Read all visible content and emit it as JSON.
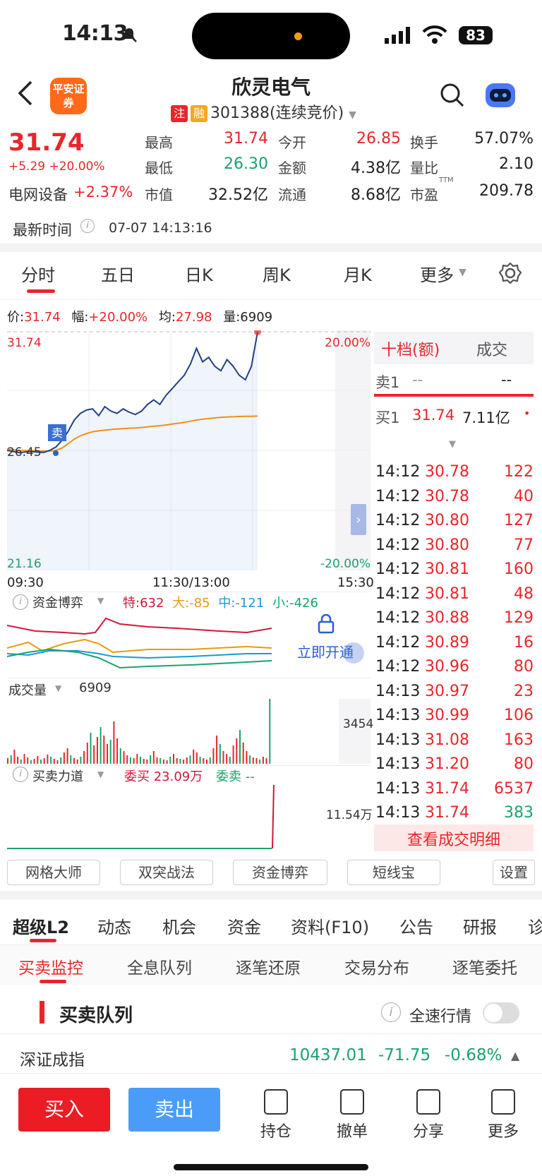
{
  "status": {
    "time": "14:13",
    "battery": "83"
  },
  "header": {
    "logo": "平安证券",
    "name": "欣灵电气",
    "badge_zhu": "注",
    "badge_rong": "融",
    "code": "301388(连续竞价)"
  },
  "quote": {
    "price": "31.74",
    "change": "+5.29 +20.00%",
    "sector": "电网设备",
    "sector_change": "+2.37%",
    "high_label": "最高",
    "high": "31.74",
    "open_label": "今开",
    "open": "26.85",
    "turnover_label": "换手",
    "turnover": "57.07%",
    "low_label": "最低",
    "low": "26.30",
    "amount_label": "金额",
    "amount": "4.38亿",
    "vol_ratio_label": "量比",
    "vol_ratio": "2.10",
    "mcap_label": "市值",
    "mcap": "32.52亿",
    "float_label": "流通",
    "float": "8.68亿",
    "pe_label": "市盈",
    "pe_sup": "TTM",
    "pe": "209.78",
    "time_label": "最新时间",
    "time_value": "07-07 14:13:16"
  },
  "chart_tabs": [
    "分时",
    "五日",
    "日K",
    "周K",
    "月K",
    "更多"
  ],
  "chart_info": {
    "price_label": "价:",
    "price": "31.74",
    "range_label": "幅:",
    "range": "+20.00%",
    "avg_label": "均:",
    "avg": "27.98",
    "vol_label": "量:",
    "vol": "6909"
  },
  "chart_data": {
    "type": "line",
    "x_labels": [
      "09:30",
      "11:30/13:00",
      "15:30"
    ],
    "y_left": [
      "31.74",
      "26.45",
      "21.16"
    ],
    "y_right": [
      "20.00%",
      "-20.00%"
    ],
    "series": [
      {
        "name": "价",
        "values": [
          26.45,
          26.4,
          26.35,
          26.38,
          26.4,
          26.37,
          26.36,
          26.45,
          26.6,
          26.9,
          27.3,
          27.8,
          28.1,
          28.25,
          28.3,
          28.0,
          28.4,
          28.2,
          28.1,
          28.3,
          28.15,
          28.05,
          28.2,
          28.5,
          28.7,
          28.5,
          28.9,
          29.2,
          29.5,
          29.8,
          30.3,
          31.0,
          30.4,
          30.6,
          30.2,
          30.0,
          30.5,
          30.2,
          29.8,
          29.6,
          30.2,
          31.74
        ]
      },
      {
        "name": "均",
        "values": [
          26.5,
          26.48,
          26.45,
          26.44,
          26.44,
          26.43,
          26.42,
          26.42,
          26.45,
          26.55,
          26.75,
          26.95,
          27.1,
          27.2,
          27.28,
          27.32,
          27.35,
          27.38,
          27.4,
          27.42,
          27.44,
          27.45,
          27.47,
          27.5,
          27.53,
          27.55,
          27.58,
          27.62,
          27.66,
          27.7,
          27.75,
          27.8,
          27.84,
          27.87,
          27.9,
          27.92,
          27.94,
          27.95,
          27.96,
          27.97,
          27.97,
          27.98
        ]
      }
    ],
    "ylim": [
      21.16,
      31.74
    ]
  },
  "order_book": {
    "tab1": "十档(额)",
    "tab2": "成交",
    "sell1_label": "卖1",
    "sell1_price": "--",
    "sell1_amt": "--",
    "buy1_label": "买1",
    "buy1_price": "31.74",
    "buy1_amt": "7.11亿"
  },
  "trades": [
    {
      "t": "14:12",
      "p": "30.78",
      "v": "122"
    },
    {
      "t": "14:12",
      "p": "30.78",
      "v": "40"
    },
    {
      "t": "14:12",
      "p": "30.80",
      "v": "127"
    },
    {
      "t": "14:12",
      "p": "30.80",
      "v": "77"
    },
    {
      "t": "14:12",
      "p": "30.81",
      "v": "160"
    },
    {
      "t": "14:12",
      "p": "30.81",
      "v": "48"
    },
    {
      "t": "14:12",
      "p": "30.88",
      "v": "129"
    },
    {
      "t": "14:12",
      "p": "30.89",
      "v": "16"
    },
    {
      "t": "14:12",
      "p": "30.96",
      "v": "80"
    },
    {
      "t": "14:13",
      "p": "30.97",
      "v": "23"
    },
    {
      "t": "14:13",
      "p": "30.99",
      "v": "106"
    },
    {
      "t": "14:13",
      "p": "31.08",
      "v": "163"
    },
    {
      "t": "14:13",
      "p": "31.20",
      "v": "80"
    },
    {
      "t": "14:13",
      "p": "31.74",
      "v": "6537"
    },
    {
      "t": "14:13",
      "p": "31.74",
      "v": "383"
    }
  ],
  "trade_detail_link": "查看成交明细",
  "fund": {
    "title": "资金博弈",
    "te": "特:632",
    "da": "大:-85",
    "zhong": "中:-121",
    "xiao": "小:-426",
    "unlock": "立即开通"
  },
  "volume": {
    "title": "成交量",
    "value": "6909",
    "scale": "3454"
  },
  "force": {
    "title": "买卖力道",
    "buy": "委买 23.09万",
    "sell": "委卖 --",
    "scale": "11.54万"
  },
  "tools": [
    "网格大师",
    "双突战法",
    "资金博弈",
    "短线宝",
    "设置"
  ],
  "info_tabs": [
    "超级L2",
    "动态",
    "机会",
    "资金",
    "资料(F10)",
    "公告",
    "研报",
    "诊"
  ],
  "sub_tabs": [
    "买卖监控",
    "全息队列",
    "逐笔还原",
    "交易分布",
    "逐笔委托"
  ],
  "queue": {
    "title": "买卖队列",
    "fast_label": "全速行情"
  },
  "index": {
    "name": "深证成指",
    "value": "10437.01",
    "change": "-71.75",
    "pct": "-0.68%"
  },
  "bottom": {
    "buy": "买入",
    "sell": "卖出",
    "items": [
      "持仓",
      "撤单",
      "分享",
      "更多"
    ]
  }
}
